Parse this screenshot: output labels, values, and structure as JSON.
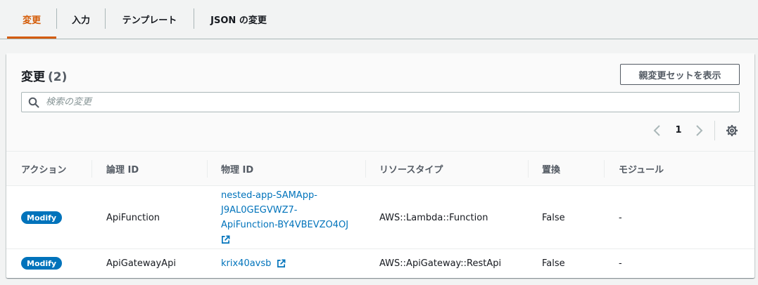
{
  "tabs": [
    {
      "label": "変更",
      "active": true
    },
    {
      "label": "入力",
      "active": false
    },
    {
      "label": "テンプレート",
      "active": false
    },
    {
      "label": "JSON の変更",
      "active": false
    }
  ],
  "panel": {
    "title": "変更",
    "count": "(2)",
    "view_changeset_button": "親変更セットを表示",
    "search_placeholder": "検索の変更",
    "page": "1"
  },
  "columns": [
    "アクション",
    "論理 ID",
    "物理 ID",
    "リソースタイプ",
    "置換",
    "モジュール"
  ],
  "rows": [
    {
      "action": "Modify",
      "logical_id": "ApiFunction",
      "physical_id_lines": [
        "nested-app-SAMApp-",
        "J9AL0GEGVWZ7-",
        "ApiFunction-BY4VBEVZO4OJ"
      ],
      "resource_type": "AWS::Lambda::Function",
      "replacement": "False",
      "module": "-"
    },
    {
      "action": "Modify",
      "logical_id": "ApiGatewayApi",
      "physical_id": "krix40avsb",
      "resource_type": "AWS::ApiGateway::RestApi",
      "replacement": "False",
      "module": "-"
    }
  ],
  "icons": {
    "search": "search-icon",
    "prev": "chevron-left-icon",
    "next": "chevron-right-icon",
    "settings": "gear-icon",
    "external": "external-link-icon"
  },
  "colors": {
    "accent_tab": "#d45b07",
    "link": "#0073bb",
    "badge": "#0073bb"
  }
}
